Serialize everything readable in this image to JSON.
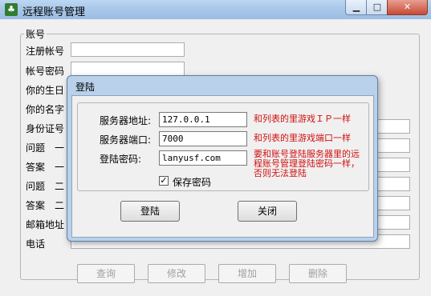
{
  "main_window": {
    "title": "远程账号管理",
    "caption_buttons": {
      "minimize": "▁",
      "maximize": "□",
      "close": "✕"
    },
    "group_label": "账号",
    "fields": [
      {
        "label": "注册帐号",
        "value": ""
      },
      {
        "label": "帐号密码",
        "value": ""
      },
      {
        "label": "你的生日",
        "value": ""
      },
      {
        "label": "你的名字",
        "value": ""
      },
      {
        "label": "身份证号",
        "value": ""
      },
      {
        "label": "问题　一",
        "value": ""
      },
      {
        "label": "答案　一",
        "value": ""
      },
      {
        "label": "问题　二",
        "value": ""
      },
      {
        "label": "答案　二",
        "value": ""
      },
      {
        "label": "邮箱地址",
        "value": ""
      },
      {
        "label": "电话",
        "value": ""
      }
    ],
    "buttons": {
      "query": "查询",
      "edit": "修改",
      "add": "增加",
      "delete": "删除"
    }
  },
  "login_dialog": {
    "title": "登陆",
    "server_address_label": "服务器地址:",
    "server_address_value": "127.0.0.1",
    "server_address_hint": "和列表的里游戏ＩＰ一样",
    "server_port_label": "服务器端口:",
    "server_port_value": "7000",
    "server_port_hint": "和列表的里游戏端口一样",
    "login_password_label": "登陆密码:",
    "login_password_value": "lanyusf.com",
    "login_password_hint": "要和账号登陆服务器里的远程账号管理登陆密码一样，否则无法登陆",
    "save_password_label": "保存密码",
    "save_password_checked": true,
    "login_button": "登陆",
    "close_button": "关闭"
  }
}
